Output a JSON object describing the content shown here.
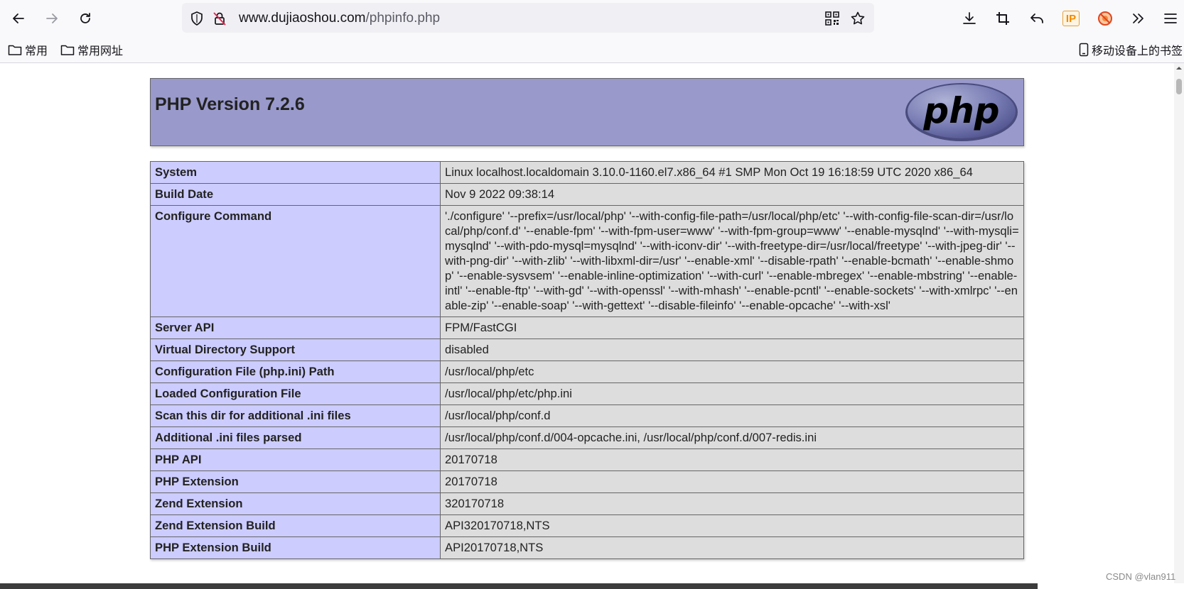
{
  "browser": {
    "url_host": "www.dujiaoshou.com",
    "url_path": "/phpinfo.php",
    "bookmarks": [
      {
        "label": "常用"
      },
      {
        "label": "常用网址"
      }
    ],
    "mobile_bookmarks": "移动设备上的书签",
    "ip_badge": "IP"
  },
  "page": {
    "title": "PHP Version 7.2.6",
    "logo_text": "php",
    "rows": [
      {
        "key": "System",
        "value": "Linux localhost.localdomain 3.10.0-1160.el7.x86_64 #1 SMP Mon Oct 19 16:18:59 UTC 2020 x86_64"
      },
      {
        "key": "Build Date",
        "value": "Nov 9 2022 09:38:14"
      },
      {
        "key": "Configure Command",
        "value": "'./configure' '--prefix=/usr/local/php' '--with-config-file-path=/usr/local/php/etc' '--with-config-file-scan-dir=/usr/local/php/conf.d' '--enable-fpm' '--with-fpm-user=www' '--with-fpm-group=www' '--enable-mysqlnd' '--with-mysqli=mysqlnd' '--with-pdo-mysql=mysqlnd' '--with-iconv-dir' '--with-freetype-dir=/usr/local/freetype' '--with-jpeg-dir' '--with-png-dir' '--with-zlib' '--with-libxml-dir=/usr' '--enable-xml' '--disable-rpath' '--enable-bcmath' '--enable-shmop' '--enable-sysvsem' '--enable-inline-optimization' '--with-curl' '--enable-mbregex' '--enable-mbstring' '--enable-intl' '--enable-ftp' '--with-gd' '--with-openssl' '--with-mhash' '--enable-pcntl' '--enable-sockets' '--with-xmlrpc' '--enable-zip' '--enable-soap' '--with-gettext' '--disable-fileinfo' '--enable-opcache' '--with-xsl'"
      },
      {
        "key": "Server API",
        "value": "FPM/FastCGI"
      },
      {
        "key": "Virtual Directory Support",
        "value": "disabled"
      },
      {
        "key": "Configuration File (php.ini) Path",
        "value": "/usr/local/php/etc"
      },
      {
        "key": "Loaded Configuration File",
        "value": "/usr/local/php/etc/php.ini"
      },
      {
        "key": "Scan this dir for additional .ini files",
        "value": "/usr/local/php/conf.d"
      },
      {
        "key": "Additional .ini files parsed",
        "value": "/usr/local/php/conf.d/004-opcache.ini, /usr/local/php/conf.d/007-redis.ini"
      },
      {
        "key": "PHP API",
        "value": "20170718"
      },
      {
        "key": "PHP Extension",
        "value": "20170718"
      },
      {
        "key": "Zend Extension",
        "value": "320170718"
      },
      {
        "key": "Zend Extension Build",
        "value": "API320170718,NTS"
      },
      {
        "key": "PHP Extension Build",
        "value": "API20170718,NTS"
      }
    ]
  },
  "watermark": "CSDN @vlan911"
}
